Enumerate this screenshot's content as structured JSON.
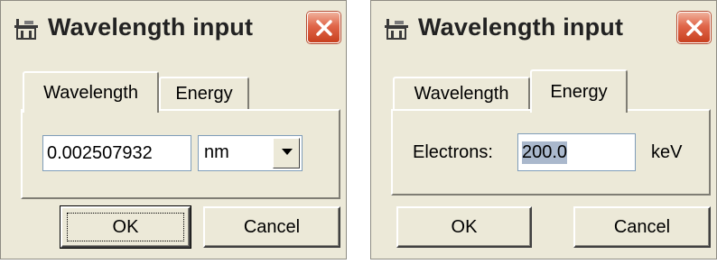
{
  "dialogs": [
    {
      "title": "Wavelength input",
      "tabs": [
        {
          "label": "Wavelength"
        },
        {
          "label": "Energy"
        }
      ],
      "selected_tab": "Wavelength",
      "wavelength_value": "0.002507932",
      "unit_selected": "nm",
      "buttons": {
        "ok": "OK",
        "cancel": "Cancel"
      }
    },
    {
      "title": "Wavelength input",
      "tabs": [
        {
          "label": "Wavelength"
        },
        {
          "label": "Energy"
        }
      ],
      "selected_tab": "Energy",
      "electrons_label": "Electrons:",
      "energy_value": "200.0",
      "energy_unit": "keV",
      "buttons": {
        "ok": "OK",
        "cancel": "Cancel"
      }
    }
  ],
  "icons": {
    "app": "wavelength-app-icon",
    "close": "close-x-icon",
    "dropdown": "triangle-down-icon"
  },
  "colors": {
    "dialog_bg": "#ece9d8",
    "close_red": "#d9553a",
    "field_border": "#7f9db9",
    "selection": "#aab8cc"
  }
}
